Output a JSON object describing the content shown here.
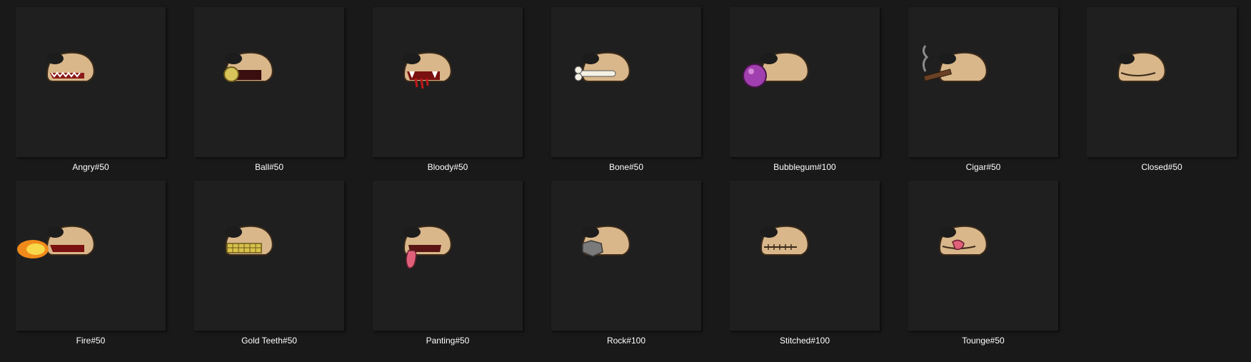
{
  "items": [
    {
      "name": "Angry#50",
      "icon": "angry-mouth-icon"
    },
    {
      "name": "Ball#50",
      "icon": "ball-mouth-icon"
    },
    {
      "name": "Bloody#50",
      "icon": "bloody-mouth-icon"
    },
    {
      "name": "Bone#50",
      "icon": "bone-mouth-icon"
    },
    {
      "name": "Bubblegum#100",
      "icon": "bubblegum-mouth-icon"
    },
    {
      "name": "Cigar#50",
      "icon": "cigar-mouth-icon"
    },
    {
      "name": "Closed#50",
      "icon": "closed-mouth-icon"
    },
    {
      "name": "Fire#50",
      "icon": "fire-mouth-icon"
    },
    {
      "name": "Gold Teeth#50",
      "icon": "gold-teeth-mouth-icon"
    },
    {
      "name": "Panting#50",
      "icon": "panting-mouth-icon"
    },
    {
      "name": "Rock#100",
      "icon": "rock-mouth-icon"
    },
    {
      "name": "Stitched#100",
      "icon": "stitched-mouth-icon"
    },
    {
      "name": "Tounge#50",
      "icon": "tounge-mouth-icon"
    }
  ],
  "colors": {
    "background": "#191919",
    "tile": "#1f1f1f",
    "snout": "#d9b78a",
    "nose": "#1c1c1c",
    "label": "#ffffff"
  }
}
